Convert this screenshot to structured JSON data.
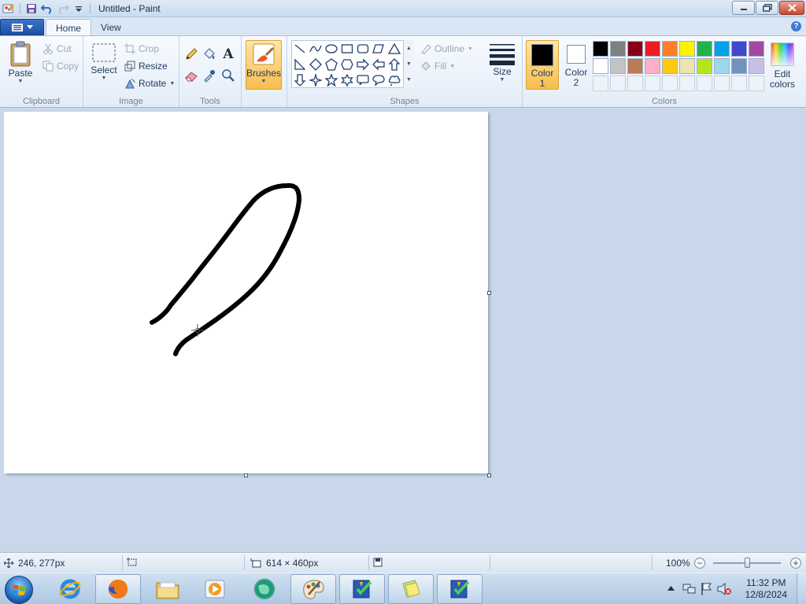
{
  "window": {
    "title": "Untitled - Paint"
  },
  "tabs": {
    "home": "Home",
    "view": "View"
  },
  "clipboard": {
    "paste": "Paste",
    "cut": "Cut",
    "copy": "Copy",
    "label": "Clipboard"
  },
  "image": {
    "select": "Select",
    "crop": "Crop",
    "resize": "Resize",
    "rotate": "Rotate",
    "label": "Image"
  },
  "tools": {
    "label": "Tools",
    "text_glyph": "A"
  },
  "brushes": {
    "label": "Brushes"
  },
  "shapes": {
    "outline": "Outline",
    "fill": "Fill",
    "label": "Shapes"
  },
  "size": {
    "label": "Size"
  },
  "colors": {
    "color1_line1": "Color",
    "color1_line2": "1",
    "color2_line1": "Color",
    "color2_line2": "2",
    "color1_value": "#000000",
    "color2_value": "#ffffff",
    "edit_line1": "Edit",
    "edit_line2": "colors",
    "label": "Colors",
    "row1": [
      "#000000",
      "#7f7f7f",
      "#880015",
      "#ed1c24",
      "#ff7f27",
      "#fff200",
      "#22b14c",
      "#00a2e8",
      "#3f48cc",
      "#a349a4"
    ],
    "row2": [
      "#ffffff",
      "#c3c3c3",
      "#b97a57",
      "#ffaec9",
      "#ffc90e",
      "#efe4b0",
      "#b5e61d",
      "#99d9ea",
      "#7092be",
      "#c8bfe7"
    ]
  },
  "statusbar": {
    "cursor_pos": "246, 277px",
    "canvas_size": "614 × 460px",
    "zoom": "100%"
  },
  "taskbar": {
    "time": "11:32 PM",
    "date": "12/8/2024"
  }
}
